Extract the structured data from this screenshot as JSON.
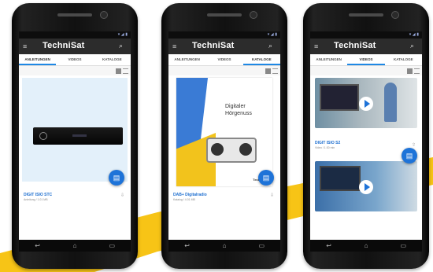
{
  "app": {
    "logo": "TechniSat"
  },
  "tabs": [
    "ANLEITUNGEN",
    "VIDEOS",
    "KATALOGE"
  ],
  "phones": [
    {
      "active_tab": 0,
      "item_title": "DIGIT ISIO STC",
      "item_subtitle": "Anleitung / 1.01 MB"
    },
    {
      "active_tab": 2,
      "poster_headline": "Digitaler Hörgenuss",
      "poster_brand": "TechniSat",
      "item_title": "DAB+ Digitalradio",
      "item_subtitle": "Katalog / 4.01 MB"
    },
    {
      "active_tab": 1,
      "item_title": "DIGIT ISIO S2",
      "item_subtitle": "Video / 1:30 min"
    }
  ],
  "colors": {
    "accent": "#1e73d8",
    "stripe": "#f7c416",
    "appbar": "#2c2c2c"
  },
  "icons": {
    "menu": "hamburger-icon",
    "search": "search-icon",
    "fab": "document-icon",
    "back": "back-icon",
    "home": "home-icon",
    "recents": "recents-icon"
  }
}
